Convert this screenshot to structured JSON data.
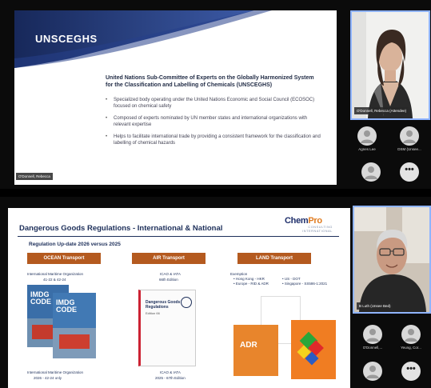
{
  "top": {
    "slide": {
      "title": "UNSCEGHS",
      "heading": "United Nations Sub-Committee of Experts on the Globally Harmonized System for the Classification and Labelling of Chemicals (UNSCEGHS)",
      "bullets": [
        "Specialized body operating under the United Nations Economic and Social Council (ECOSOC) focused on chemical safety",
        "Composed of experts nominated by UN member states and international organizations with relevant expertise",
        "Helps to facilitate international trade by providing a consistent framework for the classification and labelling of chemical hazards"
      ],
      "presenter_tag": "O'Donnell, Rebecca"
    },
    "speaker": {
      "name_tag": "O'Donnell, Rebecca (Attendee)"
    },
    "participants": [
      {
        "label": "Agnes Lee"
      },
      {
        "label": "DSM (Unsee..."
      },
      {
        "label": ""
      }
    ],
    "more_label": "•••"
  },
  "bottom": {
    "slide": {
      "title": "Dangerous Goods Regulations - International & National",
      "subtitle": "Regulation Up-date 2026 versus 2025",
      "logo": {
        "word1": "Chem",
        "word2": "Pro",
        "line1": "CONSULTING",
        "line2": "INTERNATIONAL"
      },
      "sections": {
        "ocean": {
          "label": "OCEAN Transport",
          "org_top": "International Maritime Organization",
          "amend_top": "41-22 & 42-24",
          "book_text": "IMDG CODE",
          "org_bottom": "International Maritime Organization",
          "amend_bottom": "2026 - 42-24 only"
        },
        "air": {
          "label": "AIR Transport",
          "org_top": "ICAO & IATA",
          "edition_top": "66th Edition",
          "book_title": "Dangerous Goods Regulations",
          "book_edition": "Edition 66",
          "org_bottom": "ICAO & IATA",
          "edition_bottom": "2025 - 67th Edition"
        },
        "land": {
          "label": "LAND Transport",
          "exemption": "Exemption",
          "items": [
            "Hong Kong - HKR",
            "Europe - RID & ADR",
            "US - DOT",
            "Singapore - SS586-1:2021"
          ],
          "book_text": "ADR"
        }
      }
    },
    "speaker": {
      "name_tag": "B Luth (Unsee Bed)"
    },
    "participants": [
      {
        "label": "O'Donnell,..."
      },
      {
        "label": "Yeung, Cor..."
      },
      {
        "label": ""
      }
    ],
    "more_label": "•••"
  }
}
